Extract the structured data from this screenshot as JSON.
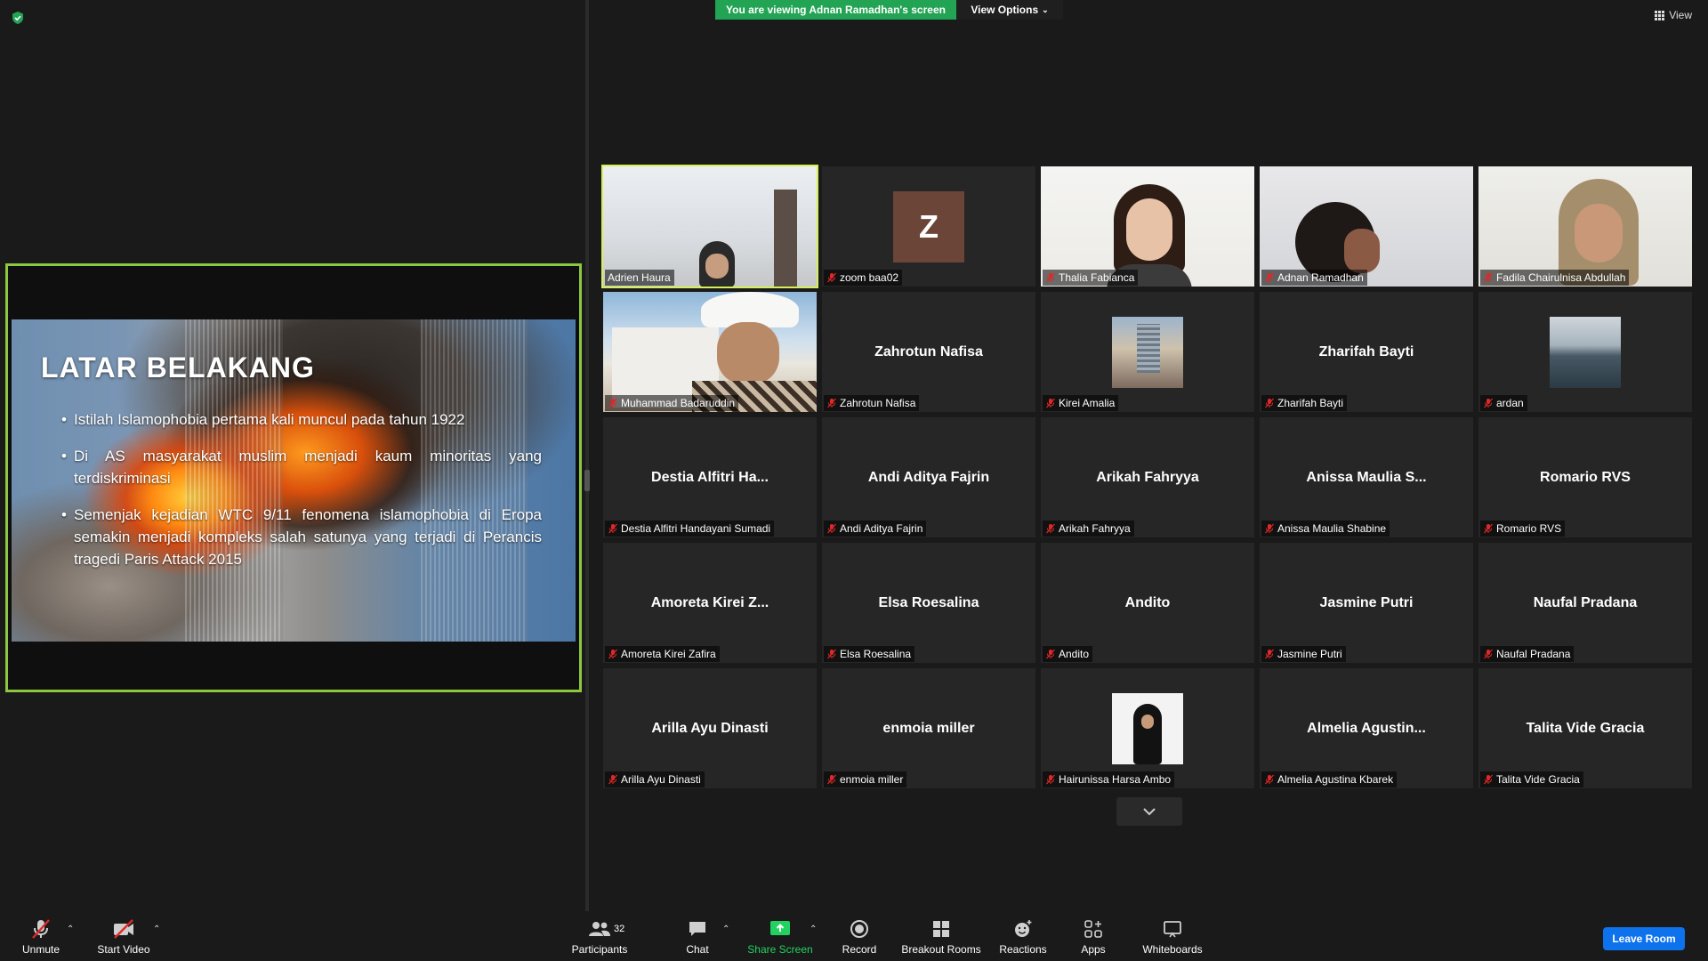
{
  "top": {
    "banner": "You are viewing Adnan Ramadhan's screen",
    "view_options": "View Options",
    "view": "View"
  },
  "slide": {
    "title": "LATAR BELAKANG",
    "bullets": [
      "Istilah Islamophobia pertama kali muncul pada tahun 1922",
      "Di AS masyarakat muslim menjadi kaum minoritas yang terdiskriminasi",
      "Semenjak kejadian WTC 9/11 fenomena islamophobia di Eropa semakin menjadi kompleks salah satunya yang terjadi di Perancis tragedi Paris Attack 2015"
    ]
  },
  "participants": [
    {
      "label": "Adrien Haura",
      "center": "",
      "kind": "cam1",
      "muted": false
    },
    {
      "label": "zoom baa02",
      "center": "",
      "kind": "avatar-z",
      "avatar_letter": "Z",
      "muted": true
    },
    {
      "label": "Thalia Fabianca",
      "center": "",
      "kind": "cam2",
      "muted": true
    },
    {
      "label": "Adnan Ramadhan",
      "center": "",
      "kind": "cam3",
      "muted": true
    },
    {
      "label": "Fadila Chairulnisa Abdullah",
      "center": "",
      "kind": "cam4",
      "muted": true
    },
    {
      "label": "Muhammad Badaruddin",
      "center": "",
      "kind": "cam5",
      "muted": true
    },
    {
      "label": "Zahrotun Nafisa",
      "center": "Zahrotun Nafisa",
      "kind": "name",
      "muted": true
    },
    {
      "label": "Kirei Amalia",
      "center": "",
      "kind": "thumb-building",
      "muted": true
    },
    {
      "label": "Zharifah Bayti",
      "center": "Zharifah Bayti",
      "kind": "name",
      "muted": true
    },
    {
      "label": "ardan",
      "center": "",
      "kind": "thumb-sea",
      "muted": true
    },
    {
      "label": "Destia Alfitri Handayani Sumadi",
      "center": "Destia Alfitri Ha...",
      "kind": "name",
      "muted": true
    },
    {
      "label": "Andi Aditya Fajrin",
      "center": "Andi Aditya Fajrin",
      "kind": "name",
      "muted": true
    },
    {
      "label": "Arikah Fahryya",
      "center": "Arikah Fahryya",
      "kind": "name",
      "muted": true
    },
    {
      "label": "Anissa Maulia Shabine",
      "center": "Anissa Maulia S...",
      "kind": "name",
      "muted": true
    },
    {
      "label": "Romario RVS",
      "center": "Romario RVS",
      "kind": "name",
      "muted": true
    },
    {
      "label": "Amoreta Kirei Zafira",
      "center": "Amoreta Kirei Z...",
      "kind": "name",
      "muted": true
    },
    {
      "label": "Elsa Roesalina",
      "center": "Elsa Roesalina",
      "kind": "name",
      "muted": true
    },
    {
      "label": "Andito",
      "center": "Andito",
      "kind": "name",
      "muted": true
    },
    {
      "label": "Jasmine Putri",
      "center": "Jasmine Putri",
      "kind": "name",
      "muted": true
    },
    {
      "label": "Naufal Pradana",
      "center": "Naufal Pradana",
      "kind": "name",
      "muted": true
    },
    {
      "label": "Arilla Ayu Dinasti",
      "center": "Arilla Ayu Dinasti",
      "kind": "name",
      "muted": true
    },
    {
      "label": "enmoia miller",
      "center": "enmoia miller",
      "kind": "name",
      "muted": true
    },
    {
      "label": "Hairunissa Harsa Ambo",
      "center": "",
      "kind": "thumb-hijab",
      "muted": true
    },
    {
      "label": "Almelia Agustina Kbarek",
      "center": "Almelia Agustin...",
      "kind": "name",
      "muted": true
    },
    {
      "label": "Talita Vide Gracia",
      "center": "Talita Vide Gracia",
      "kind": "name",
      "muted": true
    }
  ],
  "toolbar": {
    "unmute": "Unmute",
    "start_video": "Start Video",
    "participants": "Participants",
    "participants_count": "32",
    "chat": "Chat",
    "share_screen": "Share Screen",
    "record": "Record",
    "breakout_rooms": "Breakout Rooms",
    "reactions": "Reactions",
    "apps": "Apps",
    "whiteboards": "Whiteboards",
    "leave": "Leave Room"
  },
  "colors": {
    "share_accent": "#23a455",
    "active_speaker": "#d6f05a",
    "leave_button": "#0e72ed",
    "mic_muted": "#e02828"
  }
}
